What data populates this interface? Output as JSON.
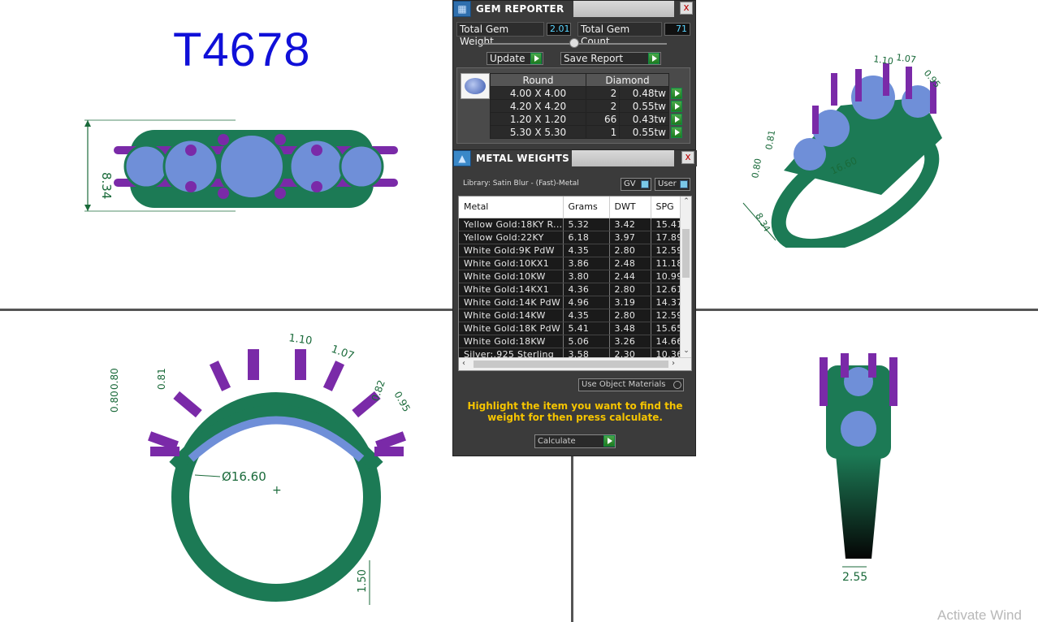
{
  "model_code": "T4678",
  "gem_reporter": {
    "title": "GEM REPORTER",
    "close_label": "x",
    "total_gem_weight_label": "Total Gem Weight",
    "total_gem_weight_value": "2.01",
    "total_gem_count_label": "Total Gem Count",
    "total_gem_count_value": "71",
    "update_label": "Update",
    "save_report_label": "Save Report",
    "table": {
      "col_shape": "Round",
      "col_type": "Diamond",
      "rows": [
        {
          "size": "4.00 X 4.00",
          "count": "2",
          "weight": "0.48tw"
        },
        {
          "size": "4.20 X 4.20",
          "count": "2",
          "weight": "0.55tw"
        },
        {
          "size": "1.20 X 1.20",
          "count": "66",
          "weight": "0.43tw"
        },
        {
          "size": "5.30 X 5.30",
          "count": "1",
          "weight": "0.55tw"
        }
      ]
    }
  },
  "metal_weights": {
    "title": "METAL WEIGHTS",
    "close_label": "x",
    "library_label": "Library: Satin Blur - (Fast)-Metal",
    "toggle_gv": "GV",
    "toggle_user": "User",
    "columns": [
      "Metal",
      "Grams",
      "DWT",
      "SPG"
    ],
    "rows": [
      {
        "metal": "Yellow Gold:18KY R...",
        "grams": "5.32",
        "dwt": "3.42",
        "spg": "15.41"
      },
      {
        "metal": "Yellow Gold:22KY",
        "grams": "6.18",
        "dwt": "3.97",
        "spg": "17.89"
      },
      {
        "metal": "White Gold:9K PdW",
        "grams": "4.35",
        "dwt": "2.80",
        "spg": "12.59"
      },
      {
        "metal": "White Gold:10KX1",
        "grams": "3.86",
        "dwt": "2.48",
        "spg": "11.18"
      },
      {
        "metal": "White Gold:10KW",
        "grams": "3.80",
        "dwt": "2.44",
        "spg": "10.99"
      },
      {
        "metal": "White Gold:14KX1",
        "grams": "4.36",
        "dwt": "2.80",
        "spg": "12.61"
      },
      {
        "metal": "White Gold:14K PdW",
        "grams": "4.96",
        "dwt": "3.19",
        "spg": "14.37"
      },
      {
        "metal": "White Gold:14KW",
        "grams": "4.35",
        "dwt": "2.80",
        "spg": "12.59"
      },
      {
        "metal": "White Gold:18K PdW",
        "grams": "5.41",
        "dwt": "3.48",
        "spg": "15.65"
      },
      {
        "metal": "White Gold:18KW",
        "grams": "5.06",
        "dwt": "3.26",
        "spg": "14.66"
      },
      {
        "metal": "Silver:.925 Sterling",
        "grams": "3.58",
        "dwt": "2.30",
        "spg": "10.36"
      }
    ],
    "use_object_materials": "Use Object Materials",
    "hint": "Highlight the item you want to find the weight for then press calculate.",
    "calculate_label": "Calculate"
  },
  "dimensions": {
    "top_width": "8.34",
    "front_w1": "1.10",
    "front_w2": "1.07",
    "front_h1": "0.80",
    "front_h2": "0.81",
    "front_h3": "0.80",
    "front_h4": "0.82",
    "front_w3": "0.95",
    "inner_diameter": "Ø16.60",
    "shank_thickness": "1.50",
    "side_width": "2.55",
    "persp_w1": "1.10",
    "persp_w2": "1.07",
    "persp_w3": "0.95",
    "persp_h1": "0.80",
    "persp_h2": "0.81",
    "persp_diam": "16.60",
    "persp_width": "8.34"
  },
  "colors": {
    "metal": "#1c7a55",
    "prong": "#7a2aa8",
    "stone": "#6f8fd8",
    "dimension": "#1a6a3a",
    "model_code": "#1010d8",
    "hint": "#f5c400"
  },
  "watermark": "Activate Wind"
}
